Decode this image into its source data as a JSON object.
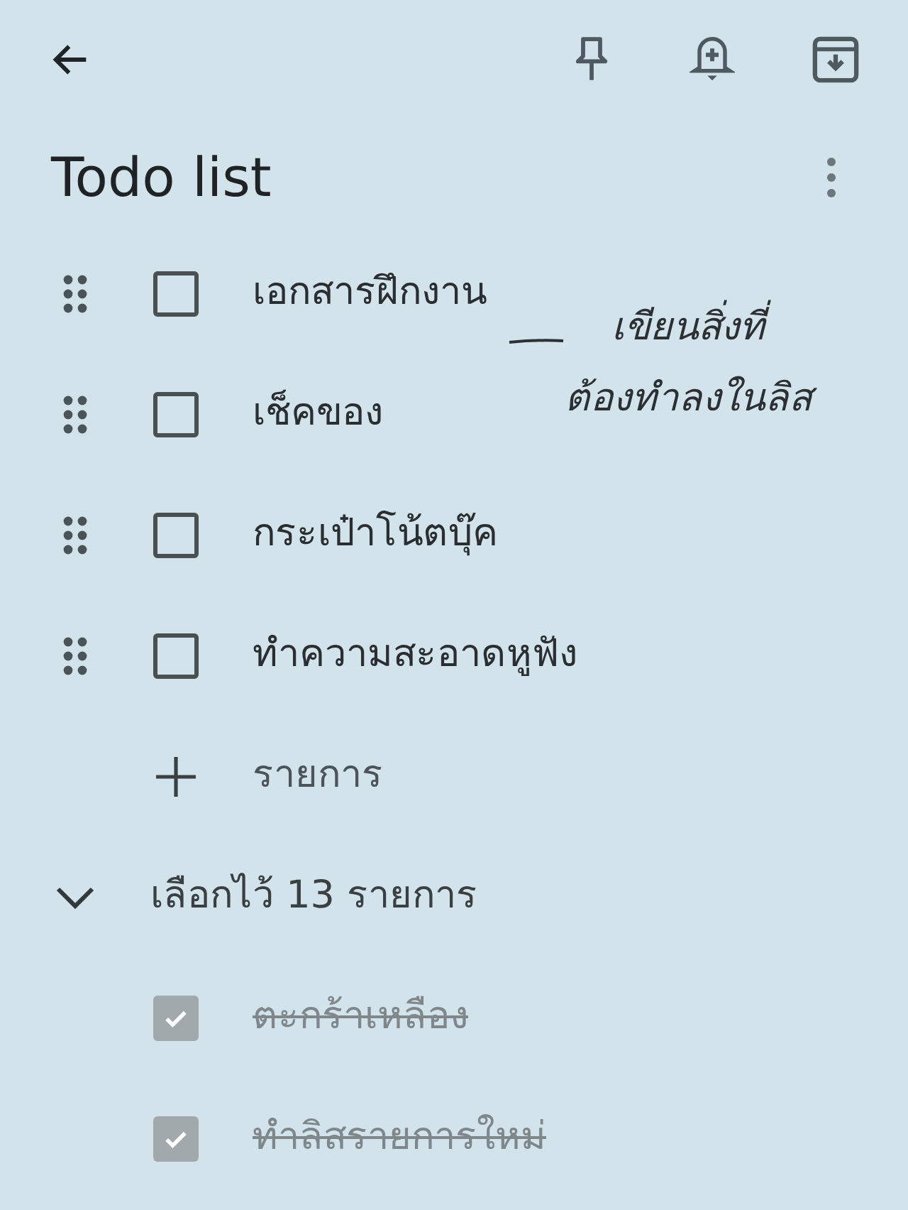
{
  "title": "Todo list",
  "items": [
    {
      "text": "เอกสารฝึกงาน",
      "checked": false
    },
    {
      "text": "เช็คของ",
      "checked": false
    },
    {
      "text": "กระเป๋าโน้ตบุ๊ค",
      "checked": false
    },
    {
      "text": "ทำความสะอาดหูฟัง",
      "checked": false
    }
  ],
  "add_item": {
    "label": "รายการ"
  },
  "completed": {
    "label": "เลือกไว้ 13 รายการ",
    "expanded": true,
    "items": [
      {
        "text": "ตะกร้าเหลือง",
        "checked": true
      },
      {
        "text": "ทำลิสรายการใหม่",
        "checked": true
      }
    ]
  },
  "annotation": {
    "lines": [
      "เขียนสิ่งที่",
      "ต้องทำลงในลิส"
    ]
  }
}
